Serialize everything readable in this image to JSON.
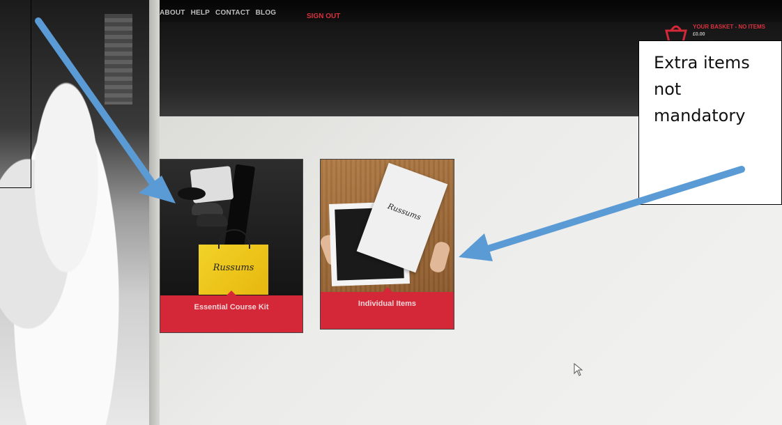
{
  "nav": {
    "links": [
      "ABOUT",
      "HELP",
      "CONTACT",
      "BLOG"
    ],
    "sign_out": "SIGN OUT"
  },
  "basket": {
    "label": "YOUR BASKET - NO ITEMS",
    "amount": "£0.00"
  },
  "cards": [
    {
      "label": "Essential Course Kit",
      "logo_text": "Russums"
    },
    {
      "label": "Individual Items",
      "logo_text": "Russums"
    }
  ],
  "annotation": {
    "lines": [
      "Extra items",
      "not",
      "mandatory"
    ]
  },
  "colors": {
    "accent_red": "#d42838",
    "arrow_blue": "#5b9bd5"
  },
  "icons": [
    "basket-icon",
    "mouse-cursor-icon",
    "arrow-annotation-icon"
  ]
}
